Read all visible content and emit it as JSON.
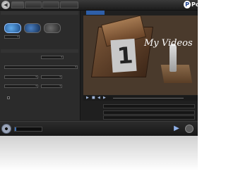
{
  "app": {
    "logo_letter": "P",
    "logo_text": "Po",
    "tabs": [
      "",
      "",
      "",
      ""
    ],
    "preview_tab": ""
  },
  "left": {
    "section1": "",
    "section1_sub": "",
    "disc_dropdown": "",
    "section2": "",
    "row1_label": "",
    "row1_value": "",
    "row2_label": "",
    "row2_value": "",
    "row3_label": "",
    "row3_value": "",
    "row3_value2": "",
    "row4_label": "",
    "row4_value": "",
    "row4_value2": "",
    "checkbox_label": ""
  },
  "preview": {
    "title": "My Videos",
    "number": "1"
  },
  "fields": [
    {
      "label": "",
      "value": ""
    },
    {
      "label": "",
      "value": ""
    },
    {
      "label": "",
      "value": ""
    }
  ],
  "bottom": {
    "capacity_text": "",
    "capacity_fraction": 0.04
  },
  "icons": {
    "back": "back-arrow-icon",
    "disc": "disc-icon",
    "burn": "burn-icon"
  }
}
